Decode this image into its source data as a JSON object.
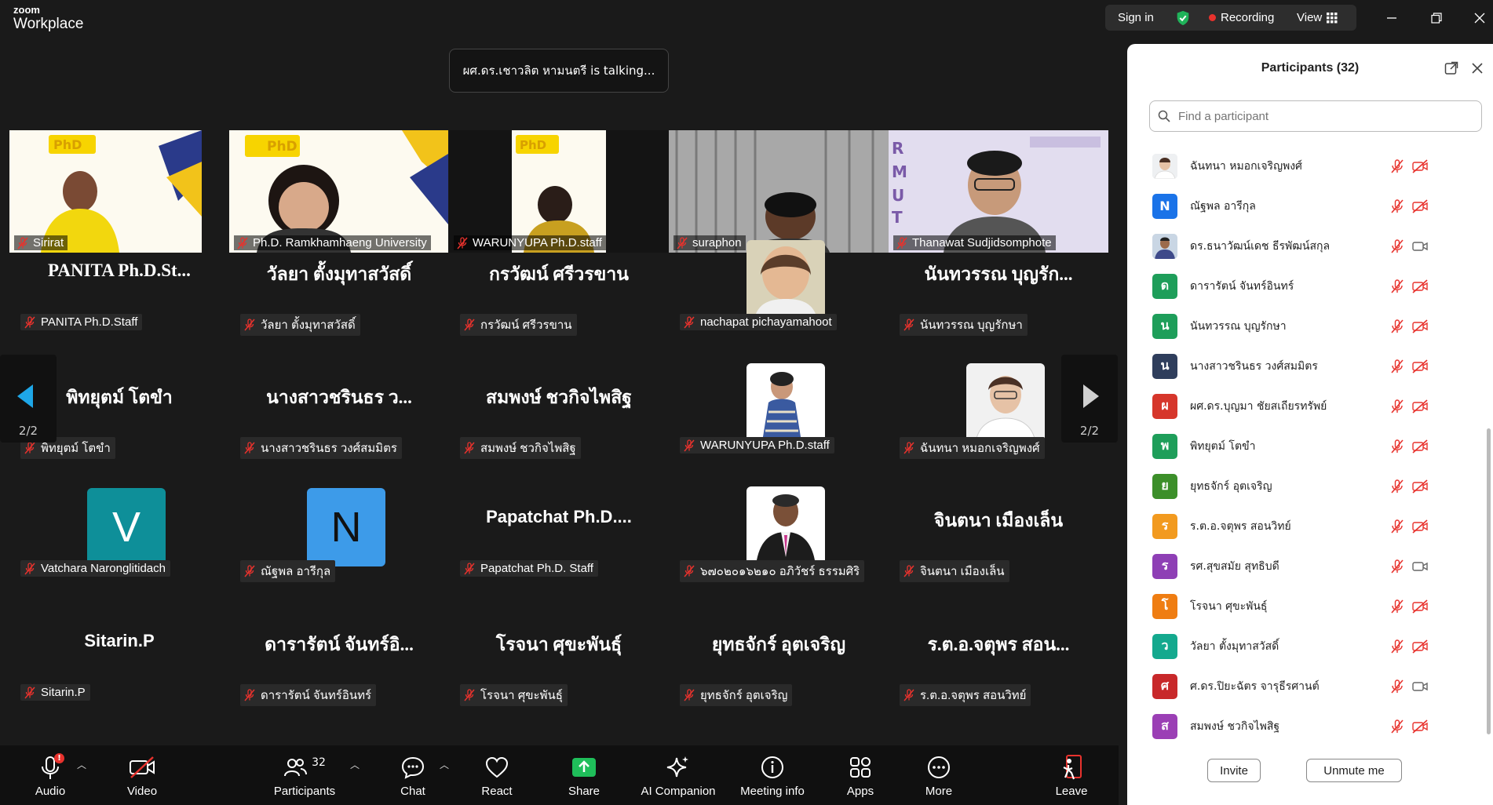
{
  "app": {
    "brand_top": "zoom",
    "brand_bottom": "Workplace"
  },
  "topbar": {
    "sign_in": "Sign in",
    "recording": "Recording",
    "view": "View"
  },
  "talking": "ผศ.ดร.เชาวลิต หามนตรี is talking...",
  "video_tiles": [
    {
      "name": "Sirirat"
    },
    {
      "name": "Ph.D. Ramkhamhaeng University"
    },
    {
      "name": "WARUNYUPA Ph.D.staff"
    },
    {
      "name": "suraphon"
    },
    {
      "name": "Thanawat Sudjidsomphote"
    }
  ],
  "grid": [
    {
      "big": "PANITA  Ph.D.St...",
      "name": "PANITA Ph.D.Staff"
    },
    {
      "big": "วัลยา ตั้งมุทาสวัสดิ์",
      "name": "วัลยา ตั้งมุทาสวัสดิ์"
    },
    {
      "big": "กรวัฒน์ ศรีวรขาน",
      "name": "กรวัฒน์ ศรีวรขาน"
    },
    {
      "big": "",
      "name": "nachapat pichayamahoot"
    },
    {
      "big": "นันทวรรณ บุญรัก...",
      "name": "นันทวรรณ บุญรักษา"
    },
    {
      "big": "พิทยุตม์ โตขำ",
      "name": "พิทยุตม์ โตขำ"
    },
    {
      "big": "นางสาวชรินธร ว...",
      "name": "นางสาวชรินธร วงศ์สมมิตร"
    },
    {
      "big": "สมพงษ์ ชวกิจไพสิฐ",
      "name": "สมพงษ์ ชวกิจไพสิฐ"
    },
    {
      "big": "",
      "name": "WARUNYUPA Ph.D.staff"
    },
    {
      "big": "",
      "name": "ฉันทนา หมอกเจริญพงศ์"
    },
    {
      "big": "",
      "name": "Vatchara Naronglitidach",
      "avatar": "V",
      "color": "#0e8f99"
    },
    {
      "big": "",
      "name": "ณัฐพล อารีกุล",
      "avatar": "N",
      "color": "#3d9be9"
    },
    {
      "big": "Papatchat  Ph.D....",
      "name": "Papatchat Ph.D. Staff"
    },
    {
      "big": "",
      "name": "๖๗๐๒๐๑๖๒๑๐ อภิวัชร์ ธรรมศิริ"
    },
    {
      "big": "จินตนา  เมืองเล็น",
      "name": "จินตนา  เมืองเล็น"
    },
    {
      "big": "Sitarin.P",
      "name": "Sitarin.P"
    },
    {
      "big": "ดารารัตน์ จันทร์อิ...",
      "name": "ดารารัตน์ จันทร์อินทร์"
    },
    {
      "big": "โรจนา ศุขะพันธุ์",
      "name": "โรจนา  ศุขะพันธุ์"
    },
    {
      "big": "ยุทธจักร์ อุตเจริญ",
      "name": "ยุทธจักร์ อุตเจริญ"
    },
    {
      "big": "ร.ต.อ.จตุพร  สอน...",
      "name": "ร.ต.อ.จตุพร  สอนวิทย์"
    }
  ],
  "nav": {
    "left_page": "2/2",
    "right_page": "2/2"
  },
  "toolbar": {
    "audio": "Audio",
    "video": "Video",
    "participants": "Participants",
    "participants_count": "32",
    "chat": "Chat",
    "react": "React",
    "share": "Share",
    "ai": "AI Companion",
    "meeting_info": "Meeting info",
    "apps": "Apps",
    "more": "More",
    "leave": "Leave"
  },
  "panel": {
    "title": "Participants (32)",
    "search_placeholder": "Find a participant",
    "participants": [
      {
        "name": "ฉันทนา หมอกเจริญพงศ์",
        "photo": true,
        "video_off": true
      },
      {
        "name": "ณัฐพล อารีกุล",
        "initial": "N",
        "color": "#1a73e8",
        "video_off": true
      },
      {
        "name": "ดร.ธนาวัฒน์เดช ธีรพัฒน์สกุล",
        "photo": true,
        "video_off": false
      },
      {
        "name": "ดารารัตน์ จันทร์อินทร์",
        "initial": "ด",
        "color": "#1e9e5a",
        "video_off": true
      },
      {
        "name": "นันทวรรณ บุญรักษา",
        "initial": "น",
        "color": "#1e9e5a",
        "video_off": true
      },
      {
        "name": "นางสาวชรินธร วงศ์สมมิตร",
        "initial": "น",
        "color": "#2f3e5c",
        "video_off": true
      },
      {
        "name": "ผศ.ดร.บุญมา ชัยสเถียรทรัพย์",
        "initial": "ผ",
        "color": "#d6362b",
        "video_off": true
      },
      {
        "name": "พิทยุตม์ โตขำ",
        "initial": "พ",
        "color": "#1e9e5a",
        "video_off": true
      },
      {
        "name": "ยุทธจักร์ อุตเจริญ",
        "initial": "ย",
        "color": "#3c8f2a",
        "video_off": true
      },
      {
        "name": "ร.ต.อ.จตุพร  สอนวิทย์",
        "initial": "ร",
        "color": "#f29a1f",
        "video_off": true
      },
      {
        "name": "รศ.สุขสมัย สุทธิบดี",
        "initial": "ร",
        "color": "#8e3fb5",
        "video_off": false
      },
      {
        "name": "โรจนา ศุขะพันธุ์",
        "initial": "โ",
        "color": "#ef7d12",
        "video_off": true
      },
      {
        "name": "วัลยา ตั้งมุทาสวัสดิ์",
        "initial": "ว",
        "color": "#14a98e",
        "video_off": true
      },
      {
        "name": "ศ.ดร.ปิยะฉัตร จารุธีรศานต์",
        "initial": "ศ",
        "color": "#c8282a",
        "video_off": false
      },
      {
        "name": "สมพงษ์ ชวกิจไพสิฐ",
        "initial": "ส",
        "color": "#9b3fb5",
        "video_off": true
      }
    ],
    "invite": "Invite",
    "unmute_me": "Unmute me"
  }
}
